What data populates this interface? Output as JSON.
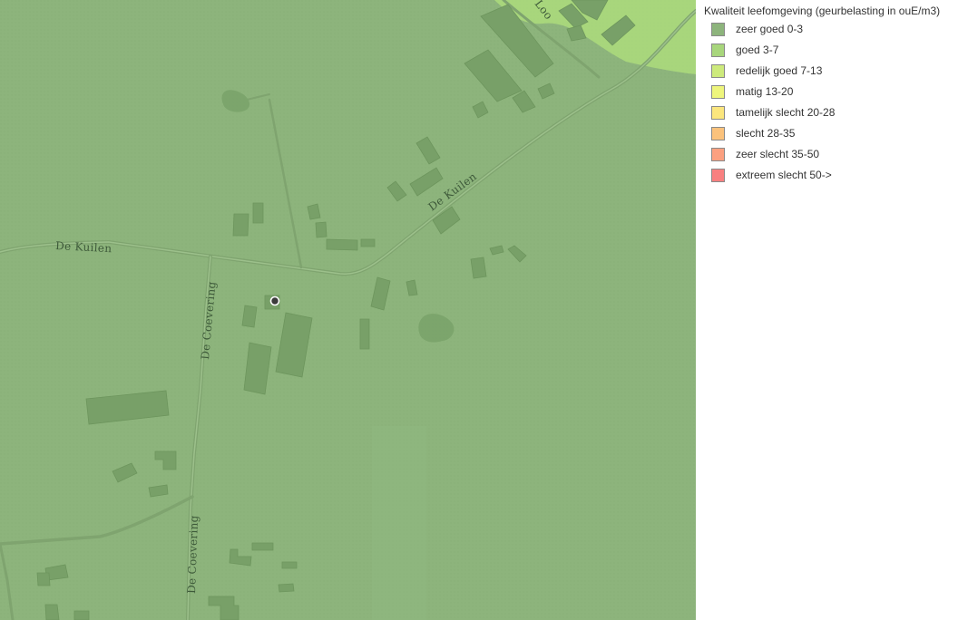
{
  "map": {
    "road_labels": [
      "De Kuilen",
      "De Kuilen",
      "De Coevering",
      "De Coevering",
      "Loo"
    ],
    "colors": {
      "zone_main": "#8db47c",
      "zone_upper": "#a8d67c",
      "road": "#7fa46f",
      "building": "#78a068"
    }
  },
  "legend": {
    "title": "Kwaliteit leefomgeving (geurbelasting in ouE/m3)",
    "items": [
      {
        "label": "zeer goed 0-3",
        "color": "#8db47c"
      },
      {
        "label": "goed 3-7",
        "color": "#a8d67c"
      },
      {
        "label": "redelijk goed 7-13",
        "color": "#cdea7c"
      },
      {
        "label": "matig 13-20",
        "color": "#eef57c"
      },
      {
        "label": "tamelijk slecht 20-28",
        "color": "#fbe67e"
      },
      {
        "label": "slecht 28-35",
        "color": "#fbc27c"
      },
      {
        "label": "zeer slecht 35-50",
        "color": "#fba080"
      },
      {
        "label": "extreem slecht 50->",
        "color": "#f88080"
      }
    ]
  }
}
